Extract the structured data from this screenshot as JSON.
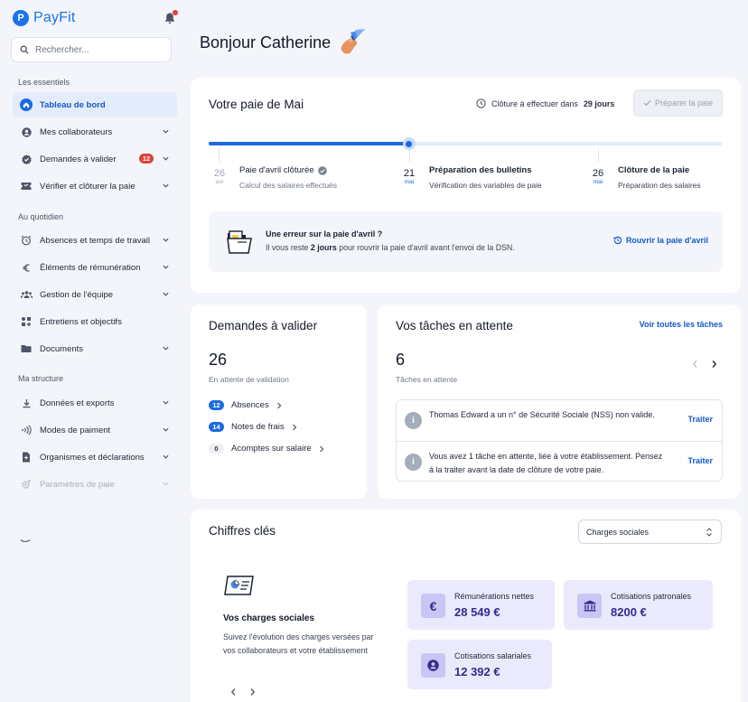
{
  "app": {
    "logo_letter": "P",
    "name": "PayFit",
    "notification_dot": true
  },
  "search": {
    "placeholder": "Rechercher..."
  },
  "sidebar": {
    "sections": [
      "Les essentiels",
      "Au quotidien",
      "Ma structure"
    ],
    "items": [
      {
        "label": "Tableau de bord",
        "icon": "home-icon",
        "active": true
      },
      {
        "label": "Mes collaborateurs",
        "icon": "person-icon"
      },
      {
        "label": "Demandes à valider",
        "icon": "check-circle-icon",
        "badge": "12"
      },
      {
        "label": "Vérifier et clôturer la paie",
        "icon": "ticket-icon"
      },
      {
        "label": "Absences et temps de travail",
        "icon": "alarm-icon"
      },
      {
        "label": "Éléments de rémunération",
        "icon": "euro-icon"
      },
      {
        "label": "Gestion de l'équipe",
        "icon": "team-icon"
      },
      {
        "label": "Entretiens et objectifs",
        "icon": "objectives-icon"
      },
      {
        "label": "Documents",
        "icon": "folder-icon"
      },
      {
        "label": "Données et exports",
        "icon": "download-icon"
      },
      {
        "label": "Modes de paiment",
        "icon": "contactless-icon"
      },
      {
        "label": "Organismes et déclarations",
        "icon": "file-icon"
      },
      {
        "label": "Paramètres de paie",
        "icon": "settings-icon",
        "disabled": true
      }
    ]
  },
  "greeting": "Bonjour Catherine",
  "payroll": {
    "title": "Votre paie de Mai",
    "closure_prefix": "Clôture à effectuer dans",
    "closure_days": "29 jours",
    "prepare_button": "Préparer la paie",
    "progress_fraction": 0.39,
    "steps": [
      {
        "day": "26",
        "month": "avr",
        "title": "Paie d'avril clôturée",
        "subtitle": "Calcul des salaires effectués",
        "done": true
      },
      {
        "day": "21",
        "month": "mai",
        "title": "Préparation des bulletins",
        "subtitle": "Vérification des variables de paie"
      },
      {
        "day": "26",
        "month": "mai",
        "title": "Clôture de la paie",
        "subtitle": "Préparation des salaires"
      }
    ],
    "alert": {
      "title": "Une erreur sur la paie d'avril ?",
      "text_prefix": "Il vous reste",
      "text_bold": "2 jours",
      "text_suffix": "pour rouvrir la paie d'avril avant l'envoi de la DSN.",
      "link": "Rouvrir la paie d'avril"
    }
  },
  "requests": {
    "title": "Demandes à valider",
    "count": "26",
    "caption": "En attente de validation",
    "rows": [
      {
        "badge": "12",
        "label": "Absences"
      },
      {
        "badge": "14",
        "label": "Notes de frais"
      },
      {
        "badge": "0",
        "label": "Acomptes sur salaire"
      }
    ]
  },
  "tasks": {
    "title": "Vos tâches en attente",
    "see_all": "Voir toutes les tâches",
    "count": "6",
    "caption": "Tâches en attente",
    "items": [
      {
        "text": "Thomas Edward a un n° de Sécurité Sociale (NSS) non valide.",
        "action": "Traiter"
      },
      {
        "text": "Vous avez 1 tâche en attente, liée à votre établissement. Pensez à la traiter avant la date de clôture de votre paie.",
        "action": "Traiter"
      }
    ]
  },
  "key_figures": {
    "title": "Chiffres clés",
    "select_value": "Charges sociales",
    "promo_title": "Vos charges sociales",
    "promo_text": "Suivez l'évolution des charges versées par vos collaborateurs et votre établissement",
    "kpis": [
      {
        "label": "Rémunérations nettes",
        "value": "28 549 €",
        "icon": "euro-icon"
      },
      {
        "label": "Cotisations patronales",
        "value": "8200 €",
        "icon": "bank-icon"
      },
      {
        "label": "Cotisations salariales",
        "value": "12 392 €",
        "icon": "person-icon"
      }
    ]
  },
  "colors": {
    "accent": "#1b6be0",
    "badge_red": "#e0413b",
    "kpi_bg": "#ebeafd",
    "kpi_text": "#322c8a"
  }
}
